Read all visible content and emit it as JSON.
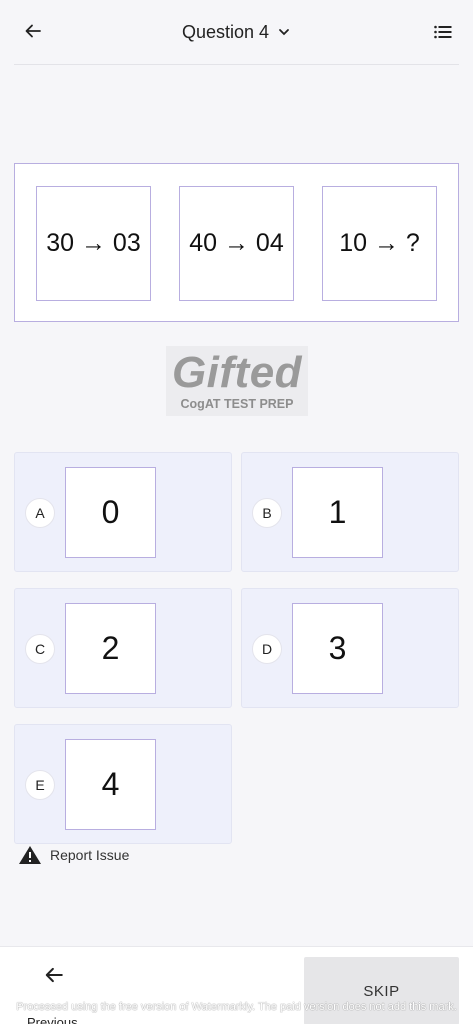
{
  "header": {
    "title": "Question 4",
    "back_icon": "arrow-left-icon",
    "dropdown_icon": "chevron-down-icon",
    "list_icon": "list-icon"
  },
  "question": {
    "items": [
      "30 → 03",
      "40 → 04",
      "10 → ?"
    ]
  },
  "logo": {
    "title": "Gifted",
    "subtitle": "CogAT TEST PREP"
  },
  "options": [
    {
      "letter": "A",
      "value": "0"
    },
    {
      "letter": "B",
      "value": "1"
    },
    {
      "letter": "C",
      "value": "2"
    },
    {
      "letter": "D",
      "value": "3"
    },
    {
      "letter": "E",
      "value": "4"
    }
  ],
  "report": {
    "label": "Report Issue",
    "icon": "warning-icon"
  },
  "footer": {
    "previous_label": "Previous",
    "skip_label": "SKIP",
    "watermark": "Processed using the free version of Watermarkly. The paid version does not add this mark."
  },
  "colors": {
    "accent_border": "#b8aee0",
    "option_bg": "#eef0fb"
  }
}
